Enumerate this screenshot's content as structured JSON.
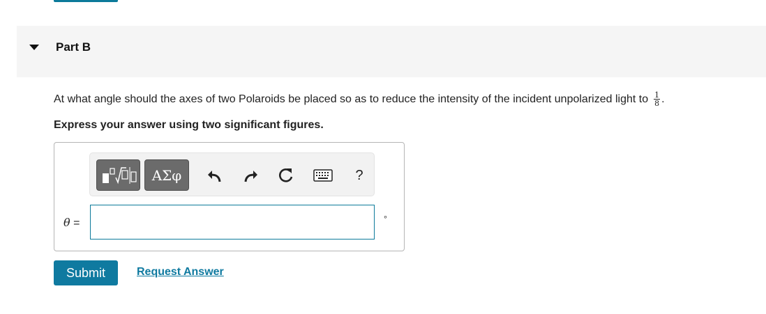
{
  "part": {
    "title": "Part B"
  },
  "question": {
    "text": "At what angle should the axes of two Polaroids be placed so as to reduce the intensity of the incident unpolarized light to",
    "fraction_numerator": "1",
    "fraction_denominator": "8",
    "end_punctuation": "."
  },
  "instruction": "Express your answer using two significant figures.",
  "toolbar": {
    "symbols_label": "ΑΣφ",
    "help_label": "?",
    "icons": [
      "templates-icon",
      "undo-icon",
      "redo-icon",
      "reset-icon",
      "keyboard-icon",
      "help-icon"
    ]
  },
  "answer": {
    "variable": "θ",
    "equals": "=",
    "value": "",
    "unit": "∘"
  },
  "actions": {
    "submit_label": "Submit",
    "request_label": "Request Answer"
  },
  "colors": {
    "accent": "#0f7aa0",
    "header_bg": "#f5f5f5",
    "toolbar_button": "#6b6b6b"
  }
}
